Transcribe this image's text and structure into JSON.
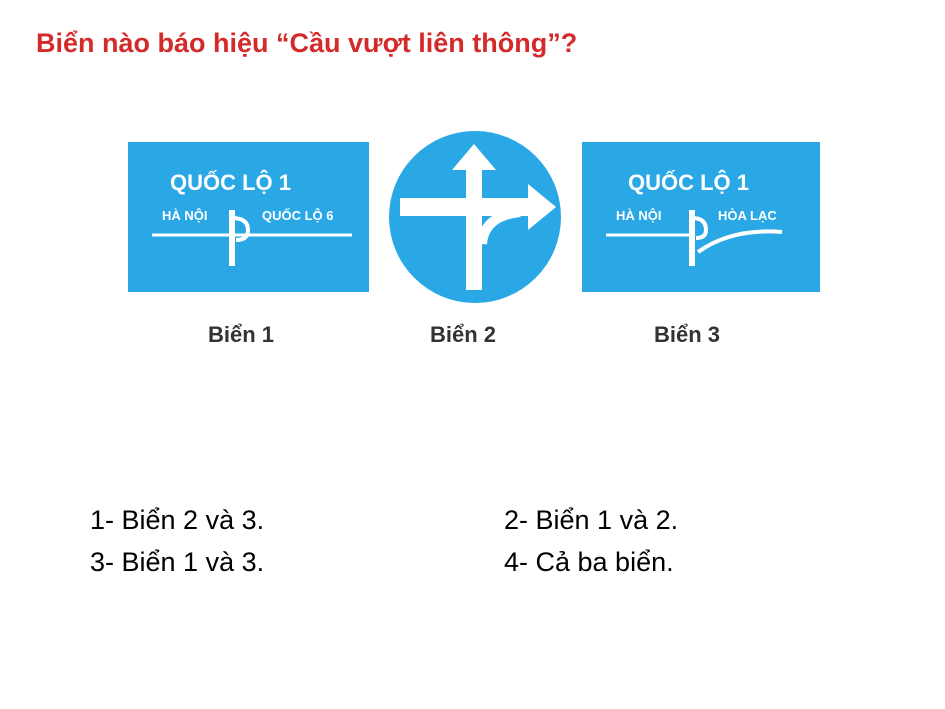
{
  "question": "Biển nào báo hiệu “Cầu vượt liên thông”?",
  "colors": {
    "question": "#d42a2a",
    "sign_blue": "#2aa8e6",
    "sign_white": "#ffffff"
  },
  "signs": [
    {
      "title": "QUỐC LỘ 1",
      "left_dest": "HÀ NỘI",
      "right_dest": "QUỐC LỘ 6",
      "caption": "Biển 1",
      "icon": "interchange-diagram"
    },
    {
      "caption": "Biển 2",
      "icon": "straight-and-right-arrow"
    },
    {
      "title": "QUỐC LỘ 1",
      "left_dest": "HÀ NỘI",
      "right_dest": "HÒA LẠC",
      "caption": "Biển 3",
      "icon": "interchange-diagram"
    }
  ],
  "answers": [
    "1- Biển 2 và 3.",
    "2- Biển 1 và 2.",
    "3- Biển 1 và 3.",
    "4- Cả ba biển."
  ]
}
